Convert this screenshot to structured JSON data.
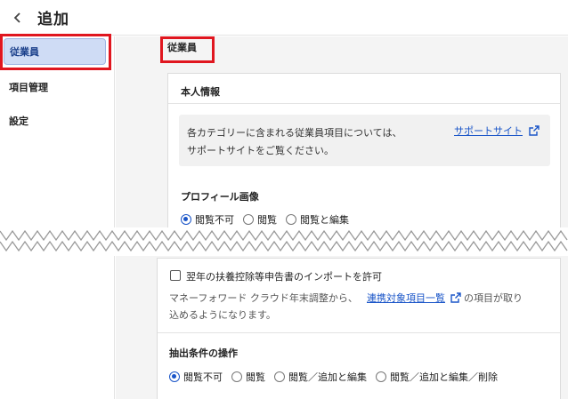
{
  "header": {
    "title": "追加"
  },
  "sidebar": {
    "items": [
      {
        "label": "従業員",
        "active": true
      },
      {
        "label": "項目管理",
        "active": false
      },
      {
        "label": "設定",
        "active": false
      }
    ]
  },
  "section": {
    "tab_label": "従業員"
  },
  "personal": {
    "title": "本人情報",
    "info_line1": "各カテゴリーに含まれる従業員項目については、",
    "info_line2": "サポートサイトをご覧ください。",
    "support_link": "サポートサイト",
    "profile_label": "プロフィール画像",
    "profile_options": [
      "閲覧不可",
      "閲覧",
      "閲覧と編集"
    ],
    "profile_selected": 0
  },
  "import": {
    "checkbox_label": "翌年の扶養控除等申告書のインポートを許可",
    "desc_before": "マネーフォワード クラウド年末調整から、",
    "desc_link": "連携対象項目一覧",
    "desc_after": "の項目が取り",
    "desc_line2": "込めるようになります。"
  },
  "extract": {
    "title": "抽出条件の操作",
    "options": [
      "閲覧不可",
      "閲覧",
      "閲覧／追加と編集",
      "閲覧／追加と編集／削除"
    ],
    "selected": 0
  },
  "colors": {
    "accent": "#1a55c8",
    "highlight": "#e0161f",
    "active_bg": "#cfdcf5"
  }
}
